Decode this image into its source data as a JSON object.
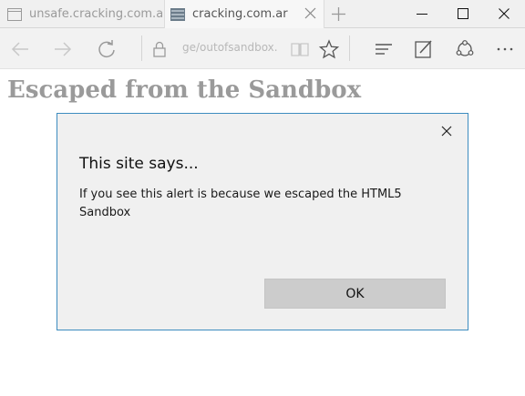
{
  "tabs": [
    {
      "label": "unsafe.cracking.com.ar",
      "active": false,
      "favicon": "page-icon"
    },
    {
      "label": "cracking.com.ar",
      "active": true,
      "favicon": "site-favicon-icon"
    }
  ],
  "toolbar": {
    "address_text": "ge/outofsandbox."
  },
  "page": {
    "heading": "Escaped from the Sandbox"
  },
  "dialog": {
    "title": "This site says...",
    "message": "If you see this alert is because we escaped the HTML5 Sandbox",
    "ok_label": "OK"
  },
  "colors": {
    "dialog_border": "#3d8cbf",
    "dialog_background": "#f0f0f0",
    "ok_button": "#cccccc",
    "heading": "#9a9a9a"
  }
}
